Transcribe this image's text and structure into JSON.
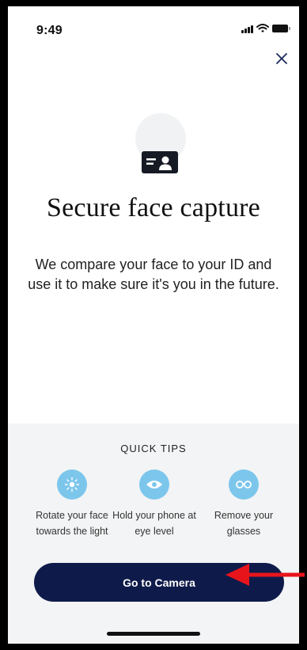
{
  "status_bar": {
    "time": "9:49"
  },
  "header": {
    "close_icon": "close-icon"
  },
  "main": {
    "illustration_icon": "id-card-icon",
    "title": "Secure face capture",
    "description": "We compare your face to your ID and use it to make sure it's you in the future."
  },
  "tips": {
    "heading": "QUICK TIPS",
    "items": [
      {
        "icon": "sun-icon",
        "label": "Rotate your face towards the light"
      },
      {
        "icon": "eye-icon",
        "label": "Hold your phone at eye level"
      },
      {
        "icon": "glasses-icon",
        "label": "Remove your glasses"
      }
    ]
  },
  "actions": {
    "camera_button_label": "Go to Camera"
  },
  "colors": {
    "primary_button": "#0e1b4a",
    "tip_icon_bg": "#7cc6ec",
    "panel_bg": "#f3f4f5",
    "annotation_arrow": "#e8141c"
  }
}
